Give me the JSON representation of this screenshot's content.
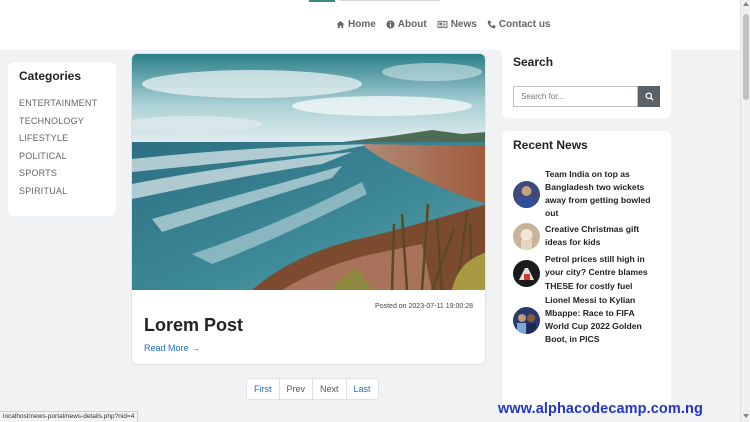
{
  "nav": {
    "items": [
      {
        "label": "Home",
        "icon": "home-icon"
      },
      {
        "label": "About",
        "icon": "info-icon"
      },
      {
        "label": "News",
        "icon": "newspaper-icon"
      },
      {
        "label": "Contact us",
        "icon": "phone-icon"
      }
    ],
    "accent_color": "#3a8c7c"
  },
  "categories": {
    "title": "Categories",
    "items": [
      "ENTERTAINMENT",
      "TECHNOLOGY",
      "LIFESTYLE",
      "POLITICAL",
      "SPORTS",
      "SPIRITUAL"
    ]
  },
  "post": {
    "meta": "Posted on 2023-07-11 19:00:28",
    "title": "Lorem Post",
    "read_more": "Read More →"
  },
  "pagination": {
    "first": "First",
    "prev": "Prev",
    "next": "Next",
    "last": "Last"
  },
  "search": {
    "title": "Search",
    "placeholder": "Search for...",
    "button_icon": "search-icon"
  },
  "recent_news": {
    "title": "Recent News",
    "items": [
      {
        "text": "Team India on top as Bangladesh two wickets away from getting bowled out"
      },
      {
        "text": "Creative Christmas gift ideas for kids"
      },
      {
        "text": "Petrol prices still high in your city? Centre blames THESE for costly fuel"
      },
      {
        "text": "Lionel Messi to Kylian Mbappe: Race to FIFA World Cup 2022 Golden Boot, in PICS"
      }
    ]
  },
  "watermark": "www.alphacodecamp.com.ng",
  "status_url": "localhost/news-portal/news-details.php?nid=4",
  "colors": {
    "link": "#1a6fd6",
    "watermark": "#2233cc",
    "search_button": "#5a6268"
  }
}
